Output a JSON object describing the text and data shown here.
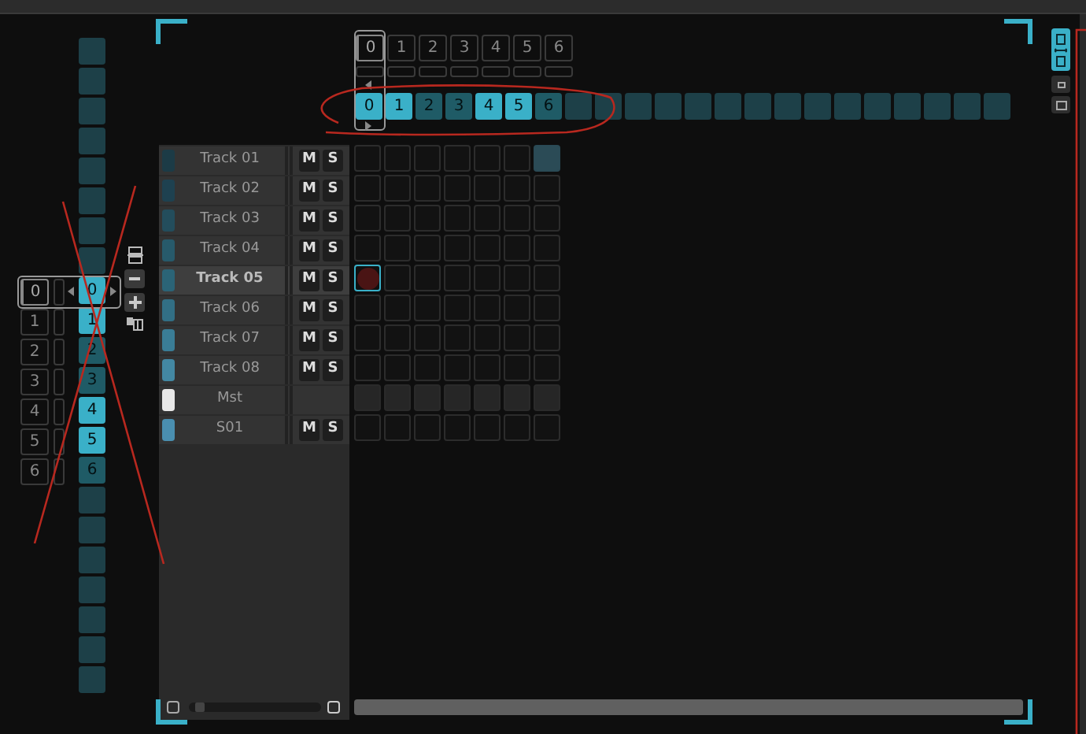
{
  "scene_list": [
    {
      "label": "0",
      "selected": true
    },
    {
      "label": "1",
      "selected": false
    },
    {
      "label": "2",
      "selected": false
    },
    {
      "label": "3",
      "selected": false
    },
    {
      "label": "4",
      "selected": false
    },
    {
      "label": "5",
      "selected": false
    },
    {
      "label": "6",
      "selected": false
    }
  ],
  "left_strip": [
    {
      "color": "#1d4048"
    },
    {
      "color": "#1d4048"
    },
    {
      "color": "#1d4048"
    },
    {
      "color": "#1d4048"
    },
    {
      "color": "#1d4048"
    },
    {
      "color": "#1d4048"
    },
    {
      "color": "#1d4048"
    },
    {
      "color": "#1d4048"
    },
    {
      "label": "0",
      "color": "#3ab0c8"
    },
    {
      "label": "1",
      "color": "#3ab0c8"
    },
    {
      "label": "2",
      "color": "#1f5b66"
    },
    {
      "label": "3",
      "color": "#1f5b66"
    },
    {
      "label": "4",
      "color": "#3ab0c8"
    },
    {
      "label": "5",
      "color": "#3ab0c8"
    },
    {
      "label": "6",
      "color": "#1f5b66"
    },
    {
      "color": "#1d4048"
    },
    {
      "color": "#1d4048"
    },
    {
      "color": "#1d4048"
    },
    {
      "color": "#1d4048"
    },
    {
      "color": "#1d4048"
    },
    {
      "color": "#1d4048"
    },
    {
      "color": "#1d4048"
    }
  ],
  "top_scenes": [
    {
      "label": "0",
      "selected": true
    },
    {
      "label": "1",
      "selected": false
    },
    {
      "label": "2",
      "selected": false
    },
    {
      "label": "3",
      "selected": false
    },
    {
      "label": "4",
      "selected": false
    },
    {
      "label": "5",
      "selected": false
    },
    {
      "label": "6",
      "selected": false
    }
  ],
  "top_strip": [
    {
      "label": "0",
      "color": "#3ab0c8"
    },
    {
      "label": "1",
      "color": "#3ab0c8"
    },
    {
      "label": "2",
      "color": "#1f5b66"
    },
    {
      "label": "3",
      "color": "#1f5b66"
    },
    {
      "label": "4",
      "color": "#3ab0c8"
    },
    {
      "label": "5",
      "color": "#3ab0c8"
    },
    {
      "label": "6",
      "color": "#1f5b66"
    },
    {
      "color": "#1d4048"
    },
    {
      "color": "#1d4048"
    },
    {
      "color": "#1d4048"
    },
    {
      "color": "#1d4048"
    },
    {
      "color": "#1d4048"
    },
    {
      "color": "#1d4048"
    },
    {
      "color": "#1d4048"
    },
    {
      "color": "#1d4048"
    },
    {
      "color": "#1d4048"
    },
    {
      "color": "#1d4048"
    },
    {
      "color": "#1d4048"
    },
    {
      "color": "#1d4048"
    },
    {
      "color": "#1d4048"
    },
    {
      "color": "#1d4048"
    },
    {
      "color": "#1d4048"
    }
  ],
  "zoom_slider": {
    "level": 0.05
  },
  "tracks": [
    {
      "name": "Track 01",
      "color": "#1c3b46",
      "selected": false,
      "mute": "M",
      "solo": "S",
      "slots": [
        {
          "kind": "empty"
        },
        {
          "kind": "empty"
        },
        {
          "kind": "empty"
        },
        {
          "kind": "empty"
        },
        {
          "kind": "empty"
        },
        {
          "kind": "empty"
        },
        {
          "kind": "clip"
        }
      ]
    },
    {
      "name": "Track 02",
      "color": "#1e4150",
      "selected": false,
      "mute": "M",
      "solo": "S",
      "slots": [
        {
          "kind": "empty"
        },
        {
          "kind": "empty"
        },
        {
          "kind": "empty"
        },
        {
          "kind": "empty"
        },
        {
          "kind": "empty"
        },
        {
          "kind": "empty"
        },
        {
          "kind": "empty"
        }
      ]
    },
    {
      "name": "Track 03",
      "color": "#234d5c",
      "selected": false,
      "mute": "M",
      "solo": "S",
      "slots": [
        {
          "kind": "empty"
        },
        {
          "kind": "empty"
        },
        {
          "kind": "empty"
        },
        {
          "kind": "empty"
        },
        {
          "kind": "empty"
        },
        {
          "kind": "empty"
        },
        {
          "kind": "empty"
        }
      ]
    },
    {
      "name": "Track 04",
      "color": "#275a6b",
      "selected": false,
      "mute": "M",
      "solo": "S",
      "slots": [
        {
          "kind": "empty"
        },
        {
          "kind": "empty"
        },
        {
          "kind": "empty"
        },
        {
          "kind": "empty"
        },
        {
          "kind": "empty"
        },
        {
          "kind": "empty"
        },
        {
          "kind": "empty"
        }
      ]
    },
    {
      "name": "Track 05",
      "color": "#2b6477",
      "selected": true,
      "mute": "M",
      "solo": "S",
      "slots": [
        {
          "kind": "record"
        },
        {
          "kind": "empty"
        },
        {
          "kind": "empty"
        },
        {
          "kind": "empty"
        },
        {
          "kind": "empty"
        },
        {
          "kind": "empty"
        },
        {
          "kind": "empty"
        }
      ]
    },
    {
      "name": "Track 06",
      "color": "#326f85",
      "selected": false,
      "mute": "M",
      "solo": "S",
      "slots": [
        {
          "kind": "empty"
        },
        {
          "kind": "empty"
        },
        {
          "kind": "empty"
        },
        {
          "kind": "empty"
        },
        {
          "kind": "empty"
        },
        {
          "kind": "empty"
        },
        {
          "kind": "empty"
        }
      ]
    },
    {
      "name": "Track 07",
      "color": "#3a7d96",
      "selected": false,
      "mute": "M",
      "solo": "S",
      "slots": [
        {
          "kind": "empty"
        },
        {
          "kind": "empty"
        },
        {
          "kind": "empty"
        },
        {
          "kind": "empty"
        },
        {
          "kind": "empty"
        },
        {
          "kind": "empty"
        },
        {
          "kind": "empty"
        }
      ]
    },
    {
      "name": "Track 08",
      "color": "#4388a3",
      "selected": false,
      "mute": "M",
      "solo": "S",
      "slots": [
        {
          "kind": "empty"
        },
        {
          "kind": "empty"
        },
        {
          "kind": "empty"
        },
        {
          "kind": "empty"
        },
        {
          "kind": "empty"
        },
        {
          "kind": "empty"
        },
        {
          "kind": "empty"
        }
      ]
    },
    {
      "name": "Mst",
      "color": "#e8e8e8",
      "selected": false,
      "slots": [
        {
          "kind": "master"
        },
        {
          "kind": "master"
        },
        {
          "kind": "master"
        },
        {
          "kind": "master"
        },
        {
          "kind": "master"
        },
        {
          "kind": "master"
        },
        {
          "kind": "master"
        }
      ]
    },
    {
      "name": "S01",
      "color": "#4a8fb0",
      "selected": false,
      "mute": "M",
      "solo": "S",
      "slots": [
        {
          "kind": "empty"
        },
        {
          "kind": "empty"
        },
        {
          "kind": "empty"
        },
        {
          "kind": "empty"
        },
        {
          "kind": "empty"
        },
        {
          "kind": "empty"
        },
        {
          "kind": "empty"
        }
      ]
    }
  ]
}
